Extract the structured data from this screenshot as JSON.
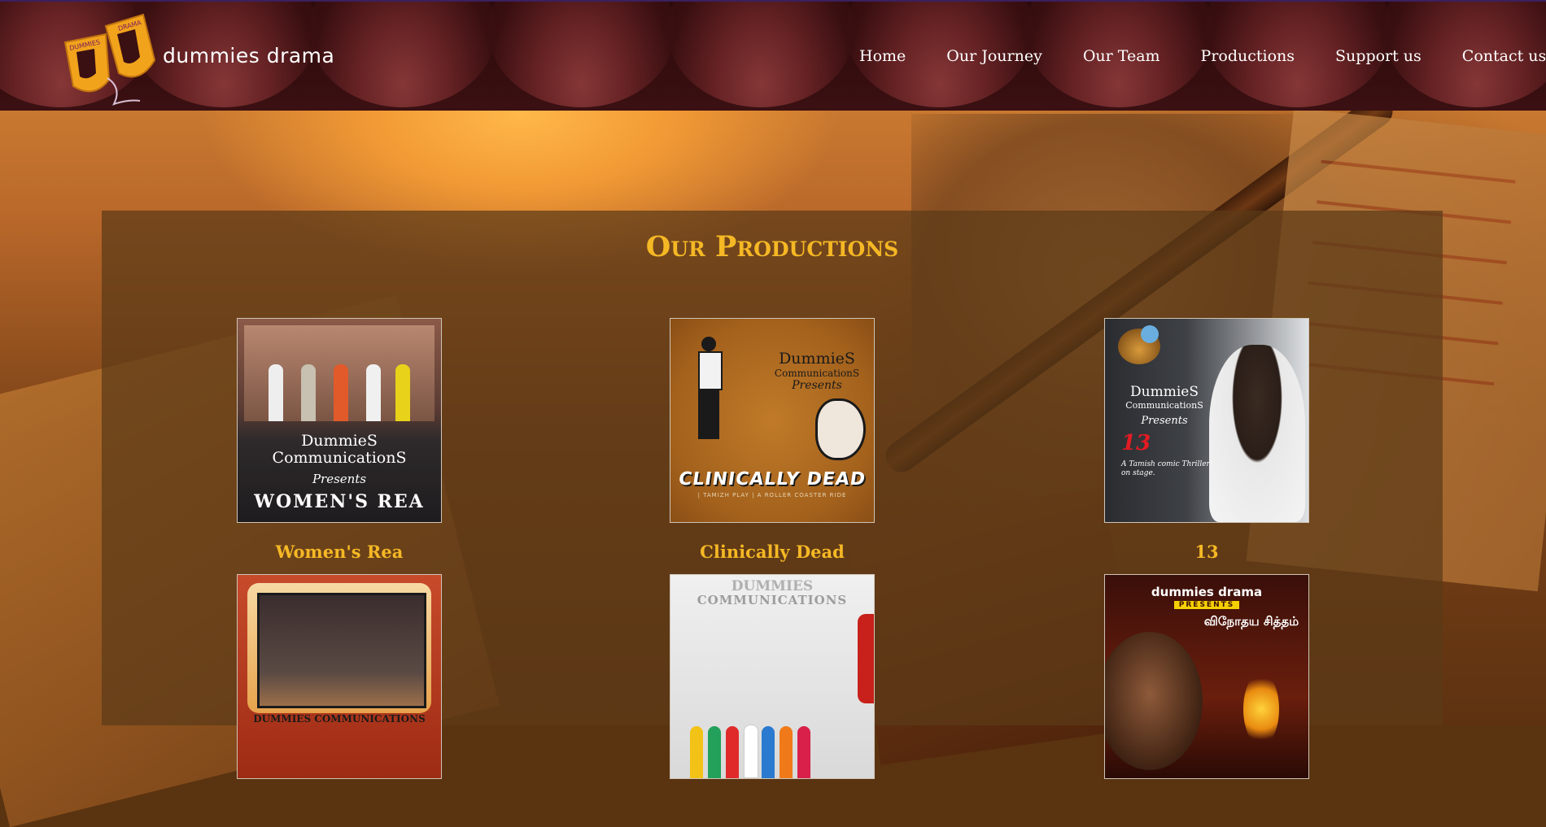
{
  "site": {
    "brand": "dummies drama",
    "logo_text_left": "DUMMIES",
    "logo_text_right": "DRAMA"
  },
  "nav": [
    {
      "label": "Home"
    },
    {
      "label": "Our Journey"
    },
    {
      "label": "Our Team"
    },
    {
      "label": "Productions"
    },
    {
      "label": "Support us"
    },
    {
      "label": "Contact us"
    }
  ],
  "main": {
    "heading": "Our Productions",
    "productions": [
      {
        "title": "Women's Rea",
        "poster": {
          "line1": "DummieS",
          "line2": "CommunicationS",
          "line3": "Presents",
          "line4": "WOMEN'S REA"
        }
      },
      {
        "title": "Clinically Dead",
        "poster": {
          "line1": "DummieS",
          "line2": "CommunicationS",
          "line3": "Presents",
          "line4": "CLINICALLY DEAD",
          "line5": "| TAMIZH PLAY | A ROLLER COASTER RIDE"
        }
      },
      {
        "title": "13",
        "poster": {
          "line1": "DummieS",
          "line2": "CommunicationS",
          "line3": "Presents",
          "line4": "13",
          "line5": "A Tamish comic Thriller on stage."
        }
      },
      {
        "title": "",
        "poster": {
          "line1": "DUMMIES COMMUNICATIONS"
        }
      },
      {
        "title": "",
        "poster": {
          "line1": "DUMMIES",
          "line2": "COMMUNICATIONS"
        }
      },
      {
        "title": "",
        "poster": {
          "line1": "dummies drama",
          "line2": "PRESENTS",
          "line3": "விநோதய சித்தம்"
        }
      }
    ]
  },
  "colors": {
    "accent": "#f5b825",
    "header_bg": "#2a0a0b",
    "nav_text": "#ffffff"
  }
}
